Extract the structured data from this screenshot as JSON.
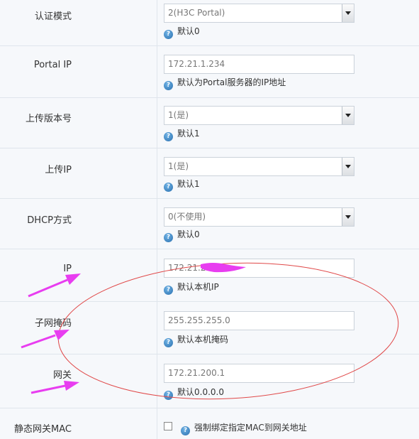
{
  "rows": [
    {
      "label": "认证模式",
      "value": "2(H3C Portal)",
      "hint": "默认0"
    },
    {
      "label": "Portal IP",
      "value": "172.21.1.234",
      "hint": "默认为Portal服务器的IP地址"
    },
    {
      "label": "上传版本号",
      "value": "1(是)",
      "hint": "默认1"
    },
    {
      "label": "上传IP",
      "value": "1(是)",
      "hint": "默认1"
    },
    {
      "label": "DHCP方式",
      "value": "0(不使用)",
      "hint": "默认0"
    },
    {
      "label": "IP",
      "value": "172.21.2",
      "hint": "默认本机IP"
    },
    {
      "label": "子网掩码",
      "value": "255.255.255.0",
      "hint": "默认本机掩码"
    },
    {
      "label": "网关",
      "value": "172.21.200.1",
      "hint": "默认0.0.0.0"
    },
    {
      "label": "静态网关MAC",
      "hint": "强制绑定指定MAC到网关地址"
    }
  ],
  "info_icon": "info-icon",
  "annotation_color": "#e83df0",
  "ellipse_color": "#e04848"
}
